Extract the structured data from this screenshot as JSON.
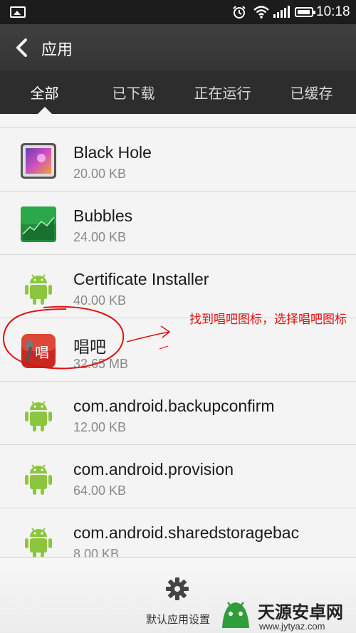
{
  "status_bar": {
    "time": "10:18"
  },
  "action_bar": {
    "title": "应用"
  },
  "tabs": [
    {
      "label": "全部",
      "active": true
    },
    {
      "label": "已下载",
      "active": false
    },
    {
      "label": "正在运行",
      "active": false
    },
    {
      "label": "已缓存",
      "active": false
    }
  ],
  "apps": [
    {
      "name": "Black Hole",
      "size": "20.00 KB",
      "icon": "black-hole-icon"
    },
    {
      "name": "Bubbles",
      "size": "24.00 KB",
      "icon": "bubbles-icon"
    },
    {
      "name": "Certificate Installer",
      "size": "40.00 KB",
      "icon": "android-icon"
    },
    {
      "name": "唱吧",
      "size": "32.65 MB",
      "icon": "changba-icon"
    },
    {
      "name": "com.android.backupconfirm",
      "size": "12.00 KB",
      "icon": "android-icon"
    },
    {
      "name": "com.android.provision",
      "size": "64.00 KB",
      "icon": "android-icon"
    },
    {
      "name": "com.android.sharedstoragebac",
      "size": "8.00 KB",
      "icon": "android-icon"
    }
  ],
  "bottom_bar": {
    "settings_label": "默认应用设置"
  },
  "annotation": {
    "text": "找到唱吧图标，选择唱吧图标",
    "color": "#e01010"
  },
  "watermark": {
    "title": "天源安卓网",
    "url": "www.jytyaz.com"
  }
}
